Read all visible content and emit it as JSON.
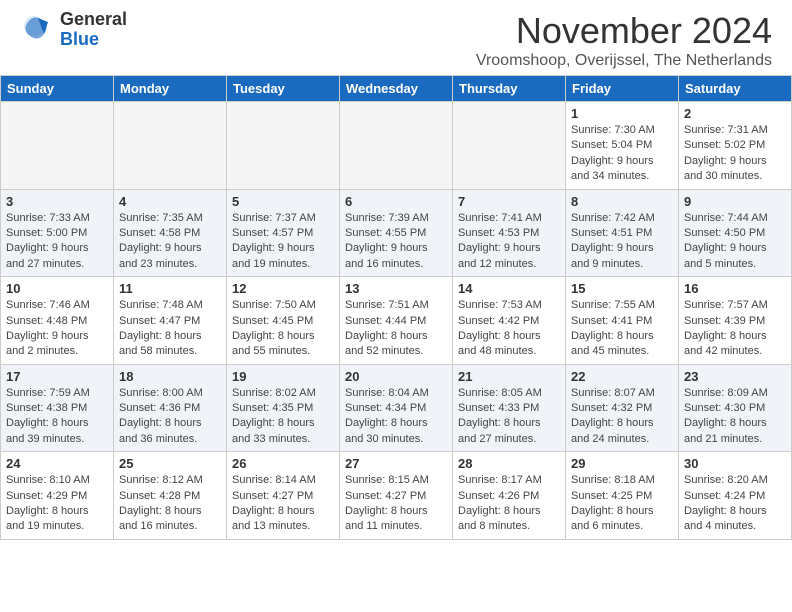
{
  "header": {
    "logo_top": "General",
    "logo_bottom": "Blue",
    "title": "November 2024",
    "location": "Vroomshoop, Overijssel, The Netherlands"
  },
  "weekdays": [
    "Sunday",
    "Monday",
    "Tuesday",
    "Wednesday",
    "Thursday",
    "Friday",
    "Saturday"
  ],
  "weeks": [
    [
      {
        "day": "",
        "info": ""
      },
      {
        "day": "",
        "info": ""
      },
      {
        "day": "",
        "info": ""
      },
      {
        "day": "",
        "info": ""
      },
      {
        "day": "",
        "info": ""
      },
      {
        "day": "1",
        "info": "Sunrise: 7:30 AM\nSunset: 5:04 PM\nDaylight: 9 hours and 34 minutes."
      },
      {
        "day": "2",
        "info": "Sunrise: 7:31 AM\nSunset: 5:02 PM\nDaylight: 9 hours and 30 minutes."
      }
    ],
    [
      {
        "day": "3",
        "info": "Sunrise: 7:33 AM\nSunset: 5:00 PM\nDaylight: 9 hours and 27 minutes."
      },
      {
        "day": "4",
        "info": "Sunrise: 7:35 AM\nSunset: 4:58 PM\nDaylight: 9 hours and 23 minutes."
      },
      {
        "day": "5",
        "info": "Sunrise: 7:37 AM\nSunset: 4:57 PM\nDaylight: 9 hours and 19 minutes."
      },
      {
        "day": "6",
        "info": "Sunrise: 7:39 AM\nSunset: 4:55 PM\nDaylight: 9 hours and 16 minutes."
      },
      {
        "day": "7",
        "info": "Sunrise: 7:41 AM\nSunset: 4:53 PM\nDaylight: 9 hours and 12 minutes."
      },
      {
        "day": "8",
        "info": "Sunrise: 7:42 AM\nSunset: 4:51 PM\nDaylight: 9 hours and 9 minutes."
      },
      {
        "day": "9",
        "info": "Sunrise: 7:44 AM\nSunset: 4:50 PM\nDaylight: 9 hours and 5 minutes."
      }
    ],
    [
      {
        "day": "10",
        "info": "Sunrise: 7:46 AM\nSunset: 4:48 PM\nDaylight: 9 hours and 2 minutes."
      },
      {
        "day": "11",
        "info": "Sunrise: 7:48 AM\nSunset: 4:47 PM\nDaylight: 8 hours and 58 minutes."
      },
      {
        "day": "12",
        "info": "Sunrise: 7:50 AM\nSunset: 4:45 PM\nDaylight: 8 hours and 55 minutes."
      },
      {
        "day": "13",
        "info": "Sunrise: 7:51 AM\nSunset: 4:44 PM\nDaylight: 8 hours and 52 minutes."
      },
      {
        "day": "14",
        "info": "Sunrise: 7:53 AM\nSunset: 4:42 PM\nDaylight: 8 hours and 48 minutes."
      },
      {
        "day": "15",
        "info": "Sunrise: 7:55 AM\nSunset: 4:41 PM\nDaylight: 8 hours and 45 minutes."
      },
      {
        "day": "16",
        "info": "Sunrise: 7:57 AM\nSunset: 4:39 PM\nDaylight: 8 hours and 42 minutes."
      }
    ],
    [
      {
        "day": "17",
        "info": "Sunrise: 7:59 AM\nSunset: 4:38 PM\nDaylight: 8 hours and 39 minutes."
      },
      {
        "day": "18",
        "info": "Sunrise: 8:00 AM\nSunset: 4:36 PM\nDaylight: 8 hours and 36 minutes."
      },
      {
        "day": "19",
        "info": "Sunrise: 8:02 AM\nSunset: 4:35 PM\nDaylight: 8 hours and 33 minutes."
      },
      {
        "day": "20",
        "info": "Sunrise: 8:04 AM\nSunset: 4:34 PM\nDaylight: 8 hours and 30 minutes."
      },
      {
        "day": "21",
        "info": "Sunrise: 8:05 AM\nSunset: 4:33 PM\nDaylight: 8 hours and 27 minutes."
      },
      {
        "day": "22",
        "info": "Sunrise: 8:07 AM\nSunset: 4:32 PM\nDaylight: 8 hours and 24 minutes."
      },
      {
        "day": "23",
        "info": "Sunrise: 8:09 AM\nSunset: 4:30 PM\nDaylight: 8 hours and 21 minutes."
      }
    ],
    [
      {
        "day": "24",
        "info": "Sunrise: 8:10 AM\nSunset: 4:29 PM\nDaylight: 8 hours and 19 minutes."
      },
      {
        "day": "25",
        "info": "Sunrise: 8:12 AM\nSunset: 4:28 PM\nDaylight: 8 hours and 16 minutes."
      },
      {
        "day": "26",
        "info": "Sunrise: 8:14 AM\nSunset: 4:27 PM\nDaylight: 8 hours and 13 minutes."
      },
      {
        "day": "27",
        "info": "Sunrise: 8:15 AM\nSunset: 4:27 PM\nDaylight: 8 hours and 11 minutes."
      },
      {
        "day": "28",
        "info": "Sunrise: 8:17 AM\nSunset: 4:26 PM\nDaylight: 8 hours and 8 minutes."
      },
      {
        "day": "29",
        "info": "Sunrise: 8:18 AM\nSunset: 4:25 PM\nDaylight: 8 hours and 6 minutes."
      },
      {
        "day": "30",
        "info": "Sunrise: 8:20 AM\nSunset: 4:24 PM\nDaylight: 8 hours and 4 minutes."
      }
    ]
  ]
}
